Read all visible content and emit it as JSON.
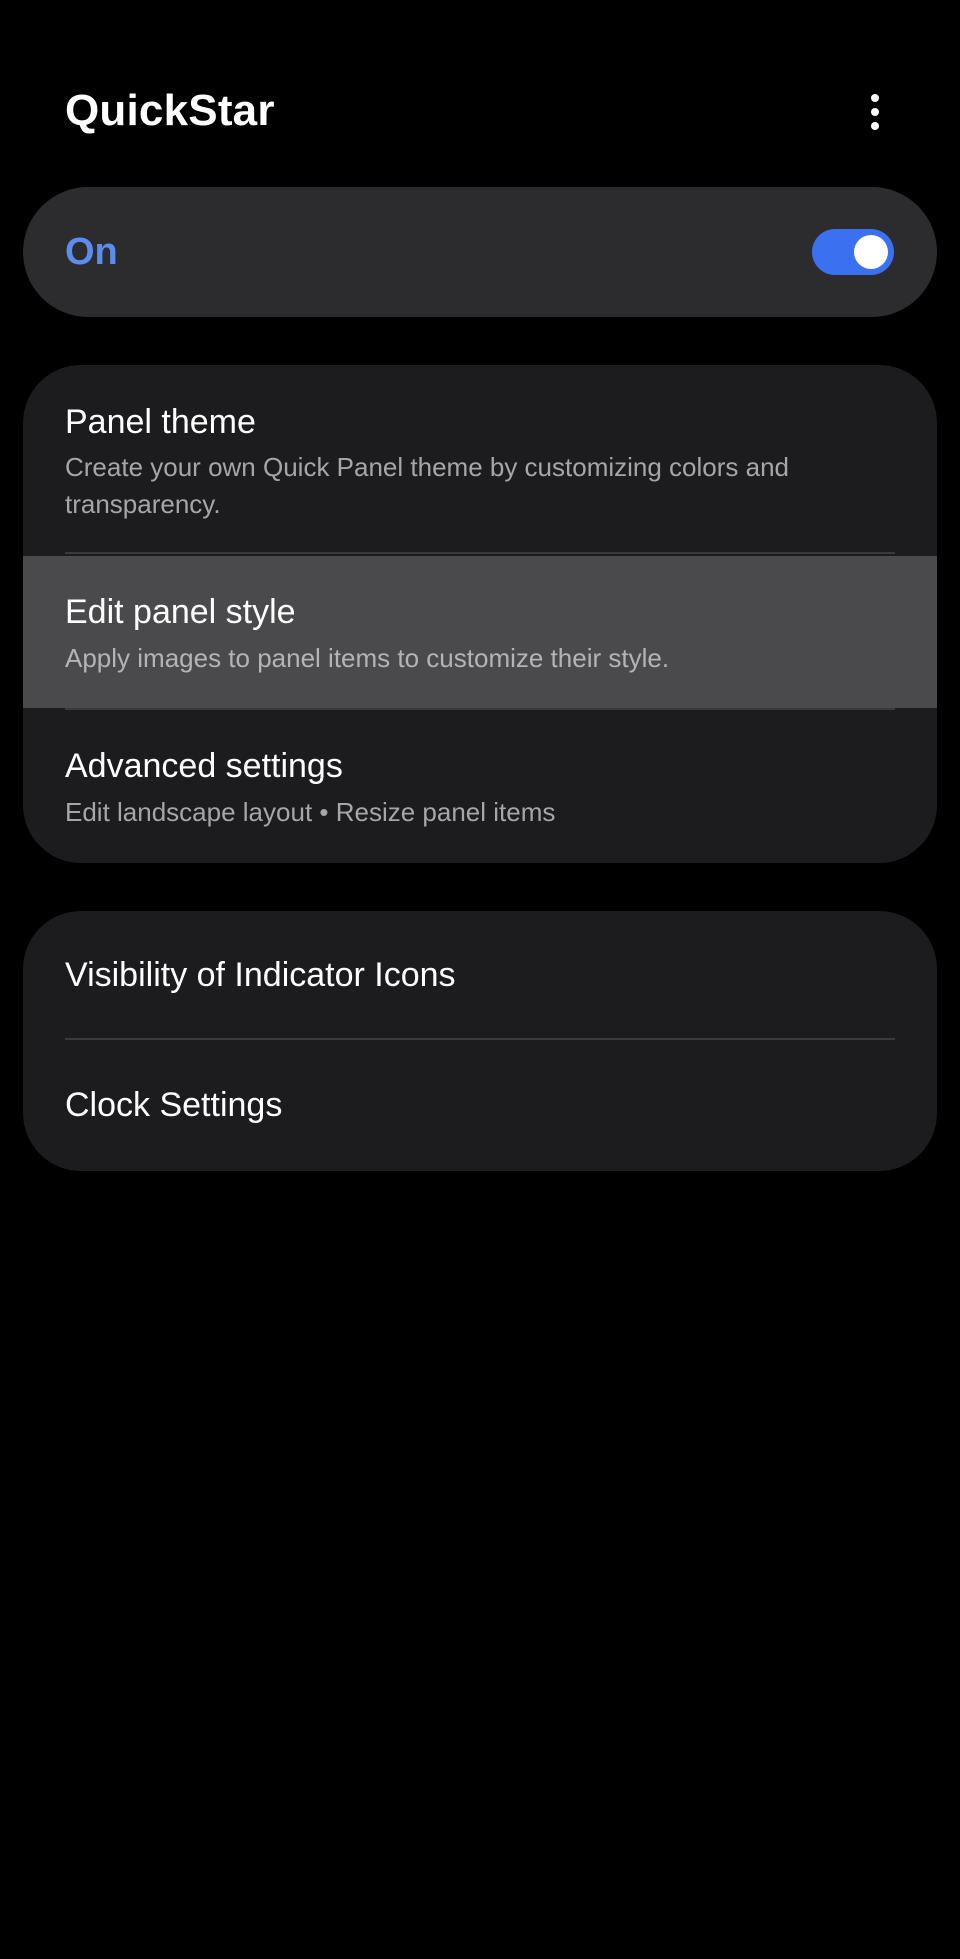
{
  "app": {
    "title": "QuickStar",
    "more_options_icon": "more-vertical-icon"
  },
  "master_switch": {
    "label": "On",
    "checked": true,
    "accent_color": "#3b71f0",
    "label_color": "#5b8def"
  },
  "settings_group_1": {
    "items": [
      {
        "title": "Panel theme",
        "subtitle": "Create your own Quick Panel theme by customizing colors and transparency."
      },
      {
        "title": "Edit panel style",
        "subtitle": "Apply images to panel items to customize their style.",
        "highlighted": true
      },
      {
        "title": "Advanced settings",
        "subtitle": "Edit landscape layout • Resize panel items"
      }
    ]
  },
  "settings_group_2": {
    "items": [
      {
        "title": "Visibility of Indicator Icons"
      },
      {
        "title": "Clock Settings"
      }
    ]
  },
  "colors": {
    "background": "#000000",
    "card_background": "#1c1c1e",
    "switch_card_background": "#2c2c2e",
    "highlight_background": "#4a4a4c",
    "subtitle_text": "#a6a6a8"
  }
}
